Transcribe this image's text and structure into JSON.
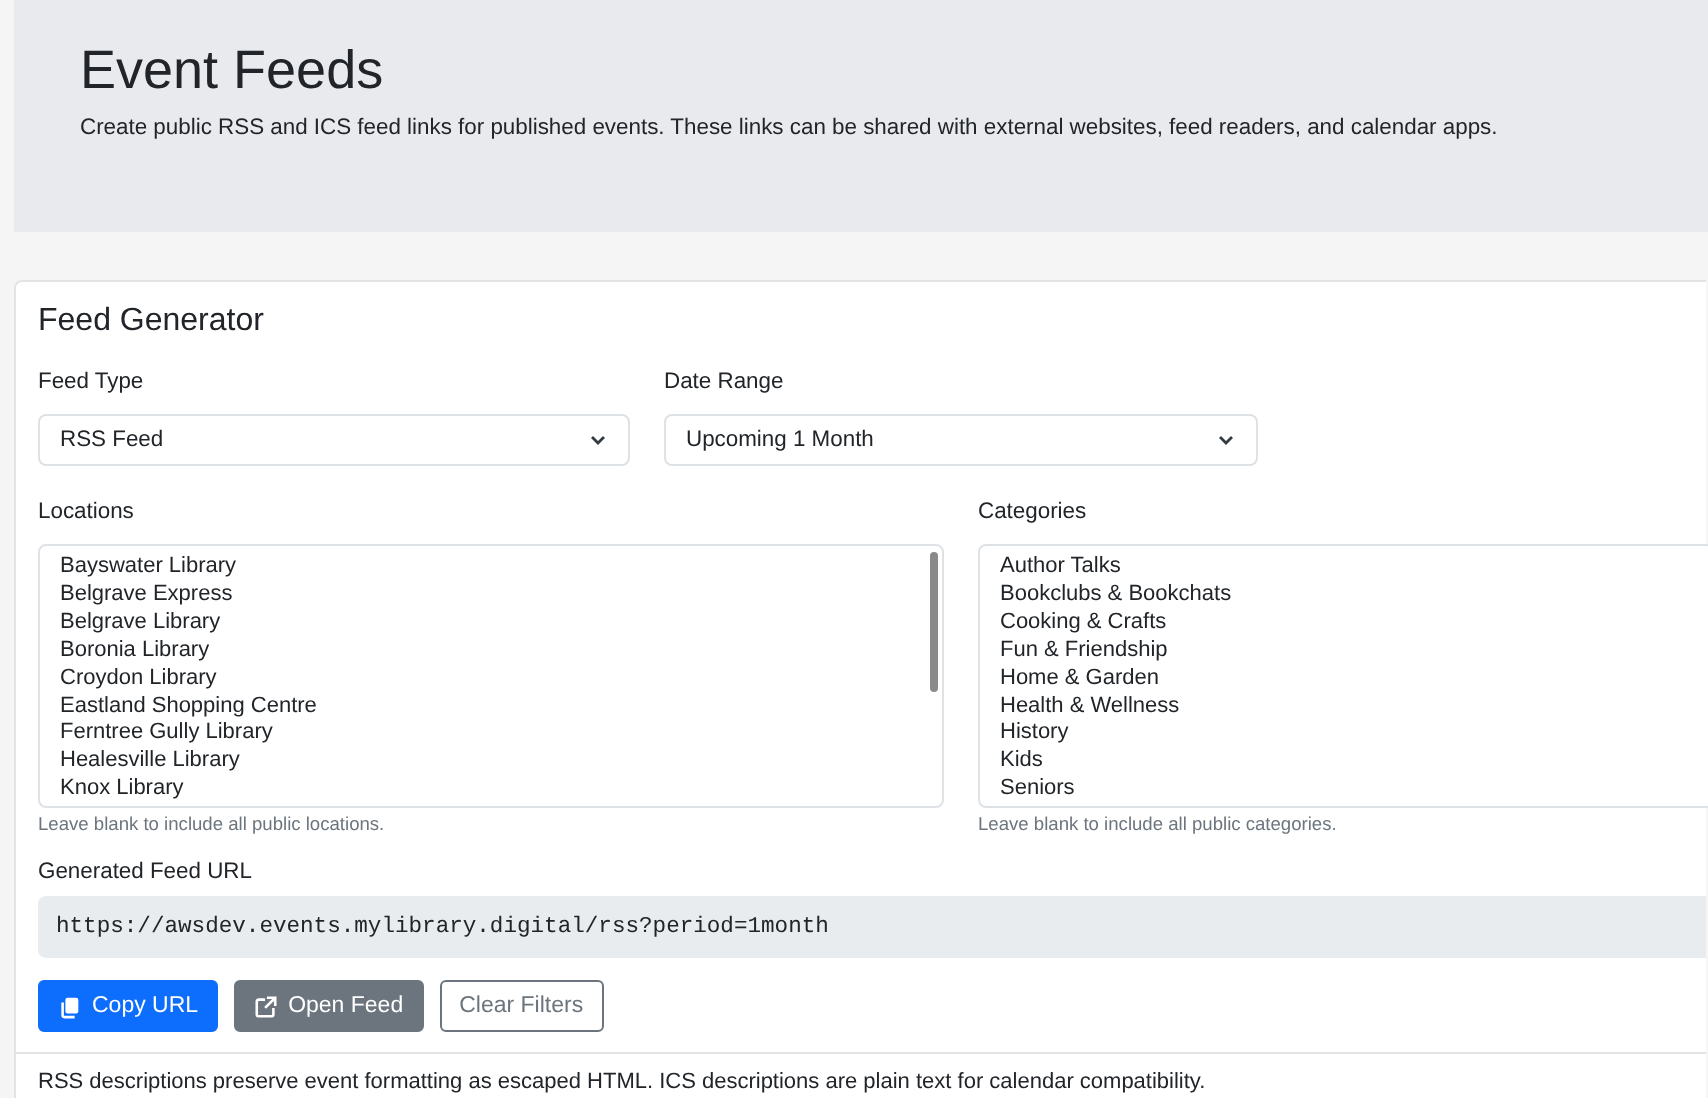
{
  "header": {
    "title": "Event Feeds",
    "description": "Create public RSS and ICS feed links for published events. These links can be shared with external websites, feed readers, and calendar apps."
  },
  "generator": {
    "title": "Feed Generator",
    "feed_type": {
      "label": "Feed Type",
      "value": "RSS Feed"
    },
    "date_range": {
      "label": "Date Range",
      "value": "Upcoming 1 Month"
    },
    "locations": {
      "label": "Locations",
      "items": [
        "Bayswater Library",
        "Belgrave Express",
        "Belgrave Library",
        "Boronia Library",
        "Croydon Library",
        "Eastland Shopping Centre",
        "Ferntree Gully Library",
        "Healesville Library",
        "Knox Library"
      ],
      "help": "Leave blank to include all public locations."
    },
    "categories": {
      "label": "Categories",
      "items": [
        "Author Talks",
        "Bookclubs & Bookchats",
        "Cooking & Crafts",
        "Fun & Friendship",
        "Home & Garden",
        "Health & Wellness",
        "History",
        "Kids",
        "Seniors"
      ],
      "help": "Leave blank to include all public categories."
    },
    "url": {
      "label": "Generated Feed URL",
      "value": "https://awsdev.events.mylibrary.digital/rss?period=1month"
    },
    "buttons": [
      {
        "label": "Copy URL",
        "kind": "primary"
      },
      {
        "label": "Open Feed",
        "kind": "secondary"
      },
      {
        "label": "Clear Filters",
        "kind": "outline"
      }
    ],
    "footer": "RSS descriptions preserve event formatting as escaped HTML. ICS descriptions are plain text for calendar compatibility."
  }
}
